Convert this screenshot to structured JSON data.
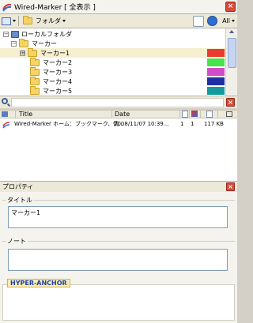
{
  "window": {
    "title": "Wired-Marker [ 全表示 ]",
    "close_label": "×"
  },
  "toolbar": {
    "folder_label": "フォルダ",
    "all_label": "All"
  },
  "tree": {
    "items": [
      {
        "label": "ローカルフォルダ",
        "expander": "−",
        "type": "drive"
      },
      {
        "label": "マーカー",
        "expander": "−",
        "type": "folder"
      },
      {
        "label": "マーカー1",
        "expander": "⊞",
        "type": "folder",
        "color": "#ea3b2e",
        "selected": true
      },
      {
        "label": "マーカー2",
        "type": "folder",
        "color": "#47e34a"
      },
      {
        "label": "マーカー3",
        "type": "folder",
        "color": "#d24bc8"
      },
      {
        "label": "マーカー4",
        "type": "folder",
        "color": "#1f2fa3"
      },
      {
        "label": "マーカー5",
        "type": "folder",
        "color": "#149a9c"
      }
    ]
  },
  "search": {
    "value": ""
  },
  "list": {
    "columns": [
      "Title",
      "Date"
    ],
    "rows": [
      {
        "title": "Wired-Marker ホーム：ブックマーク、情...",
        "date": "2008/11/07 10:39...",
        "c1": "1",
        "c2": "1",
        "size": "117 KB"
      }
    ]
  },
  "properties": {
    "header": "プロパティ",
    "title_label": "タイトル",
    "title_value": "マーカー1",
    "note_label": "ノート",
    "note_value": "",
    "anchor_label": "HYPER-ANCHOR"
  }
}
